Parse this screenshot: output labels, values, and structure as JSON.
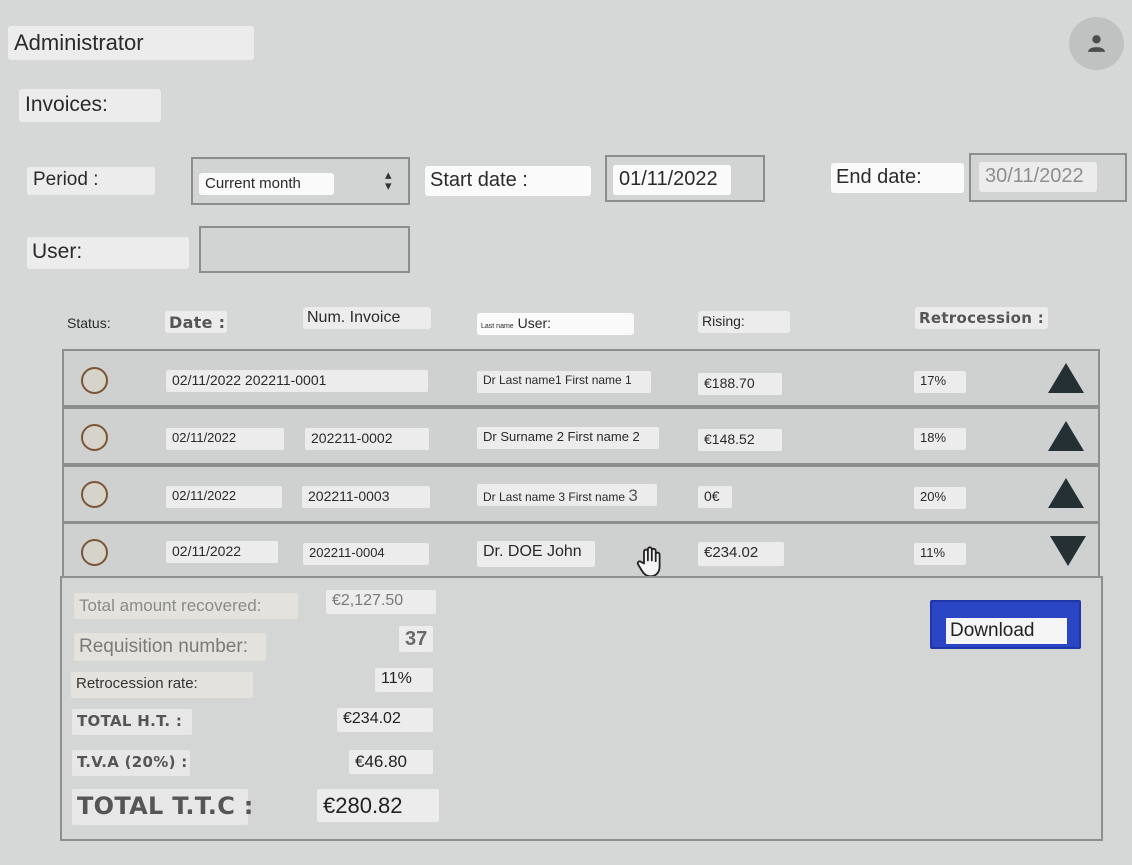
{
  "header": {
    "app_title": "Administrator",
    "avatar_icon": "user-icon"
  },
  "page": {
    "title": "Invoices:"
  },
  "filters": {
    "period_label": "Period :",
    "period_value": "Current month",
    "start_label": "Start date :",
    "start_value": "01/11/2022",
    "end_label": "End date:",
    "end_value": "30/11/2022",
    "user_label": "User:",
    "user_value": ""
  },
  "table": {
    "headers": {
      "status": "Status:",
      "date": "Date :",
      "num": "Num. Invoice",
      "user_small": "Last name",
      "user": "User:",
      "rising": "Rising:",
      "retro": "Retrocession :"
    },
    "rows": [
      {
        "date": "02/11/2022",
        "num": "202211-0001",
        "user": "Dr Last name1 First name 1",
        "rising": "€188.70",
        "retro": "17%",
        "toggle": "up"
      },
      {
        "date": "02/11/2022",
        "num": "202211-0002",
        "user": "Dr Surname 2 First name 2",
        "rising": "€148.52",
        "retro": "18%",
        "toggle": "up"
      },
      {
        "date": "02/11/2022",
        "num": "202211-0003",
        "user": "Dr Last name 3 First name",
        "user_suffix": "3",
        "rising": "0€",
        "retro": "20%",
        "toggle": "up"
      },
      {
        "date": "02/11/2022",
        "num": "202211-0004",
        "user": "Dr. DOE John",
        "rising": "€234.02",
        "retro": "11%",
        "toggle": "down"
      }
    ]
  },
  "summary": {
    "total_recovered_label": "Total amount recovered:",
    "total_recovered_value": "€2,127.50",
    "requisition_label": "Requisition number:",
    "requisition_value": "37",
    "retro_rate_label": "Retrocession rate:",
    "retro_rate_value": "11%",
    "total_ht_label": "TOTAL H.T. :",
    "total_ht_value": "€234.02",
    "tva_label": "T.V.A (20%) :",
    "tva_value": "€46.80",
    "total_ttc_label": "TOTAL T.T.C :",
    "total_ttc_value": "€280.82",
    "download_label": "Download"
  },
  "colors": {
    "background": "#d6d8d7",
    "download_button": "#2b46c4",
    "toggle_arrow": "#253035",
    "status_circle": "#7b5536"
  }
}
